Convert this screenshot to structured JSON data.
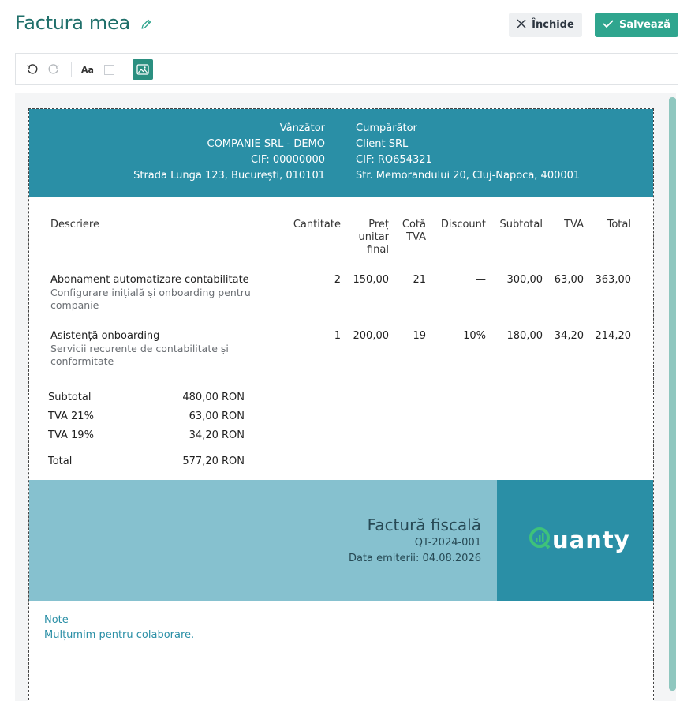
{
  "header": {
    "title": "Factura mea",
    "close_label": "Închide",
    "save_label": "Salvează"
  },
  "toolbar": {
    "font_label": "Aa"
  },
  "invoice": {
    "seller": {
      "heading": "Vânzător",
      "name": "COMPANIE SRL - DEMO",
      "cif": "CIF: 00000000",
      "address": "Strada Lunga 123, București, 010101"
    },
    "buyer": {
      "heading": "Cumpărător",
      "name": "Client SRL",
      "cif": "CIF: RO654321",
      "address": "Str. Memorandului 20, Cluj-Napoca, 400001"
    },
    "columns": {
      "description": "Descriere",
      "quantity": "Cantitate",
      "price_1": "Preț",
      "price_2": "unitar",
      "price_3": "final",
      "rate_1": "Cotă",
      "rate_2": "TVA",
      "discount": "Discount",
      "subtotal": "Subtotal",
      "vat": "TVA",
      "total": "Total"
    },
    "items": [
      {
        "name": "Abonament automatizare contabilitate",
        "desc_1": "Configurare inițială și onboarding pentru",
        "desc_2": "companie",
        "quantity": "2",
        "price": "150,00",
        "rate": "21",
        "discount": "—",
        "subtotal": "300,00",
        "vat": "63,00",
        "total": "363,00"
      },
      {
        "name": "Asistență onboarding",
        "desc_1": "Servicii recurente de contabilitate și",
        "desc_2": "conformitate",
        "quantity": "1",
        "price": "200,00",
        "rate": "19",
        "discount": "10%",
        "subtotal": "180,00",
        "vat": "34,20",
        "total": "214,20"
      }
    ],
    "totals": {
      "subtotal_label": "Subtotal",
      "subtotal_value": "480,00 RON",
      "vat21_label": "TVA 21%",
      "vat21_value": "63,00 RON",
      "vat19_label": "TVA 19%",
      "vat19_value": "34,20 RON",
      "total_label": "Total",
      "total_value": "577,20 RON"
    },
    "footer": {
      "doc_title": "Factură fiscală",
      "doc_number": "QT-2024-001",
      "issue_date": "Data emiterii: 04.08.2026",
      "logo_text": "uanty"
    },
    "notes": {
      "label": "Note",
      "text": "Mulțumim pentru colaborare."
    }
  },
  "colors": {
    "accent": "#2fa58e",
    "title": "#1f6f6a",
    "header_band": "#2a8fa6",
    "footer_light": "#86c1cf",
    "logo_green": "#3ec27a"
  },
  "icons": [
    "edit-pencil-icon",
    "close-x-icon",
    "check-icon",
    "undo-icon",
    "redo-icon",
    "image-icon"
  ]
}
